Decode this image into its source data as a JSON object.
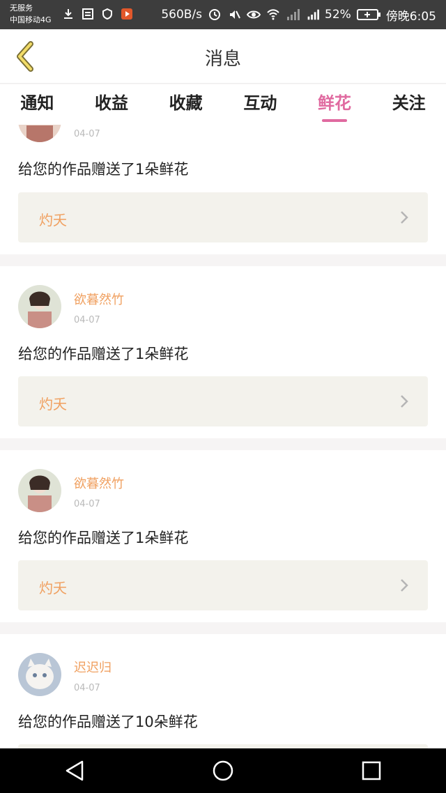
{
  "status": {
    "left_line1": "无服务",
    "left_line2": "中国移动4G",
    "speed": "560B/s",
    "battery_pct": "52%",
    "time": "傍晚6:05",
    "signal_label": "4G"
  },
  "header": {
    "title": "消息"
  },
  "tabs": [
    {
      "label": "通知",
      "active": false
    },
    {
      "label": "收益",
      "active": false
    },
    {
      "label": "收藏",
      "active": false
    },
    {
      "label": "互动",
      "active": false
    },
    {
      "label": "鲜花",
      "active": true
    },
    {
      "label": "关注",
      "active": false
    }
  ],
  "items": [
    {
      "name": "",
      "date": "04-07",
      "message": "给您的作品赠送了1朵鲜花",
      "work_title": "灼夭"
    },
    {
      "name": "欲暮然竹",
      "date": "04-07",
      "message": "给您的作品赠送了1朵鲜花",
      "work_title": "灼夭"
    },
    {
      "name": "欲暮然竹",
      "date": "04-07",
      "message": "给您的作品赠送了1朵鲜花",
      "work_title": "灼夭"
    },
    {
      "name": "迟迟归",
      "date": "04-07",
      "message": "给您的作品赠送了10朵鲜花",
      "work_title": ""
    }
  ],
  "colors": {
    "accent": "#e06aa0",
    "name": "#f0a060",
    "work_bg": "#f3f2ec"
  }
}
